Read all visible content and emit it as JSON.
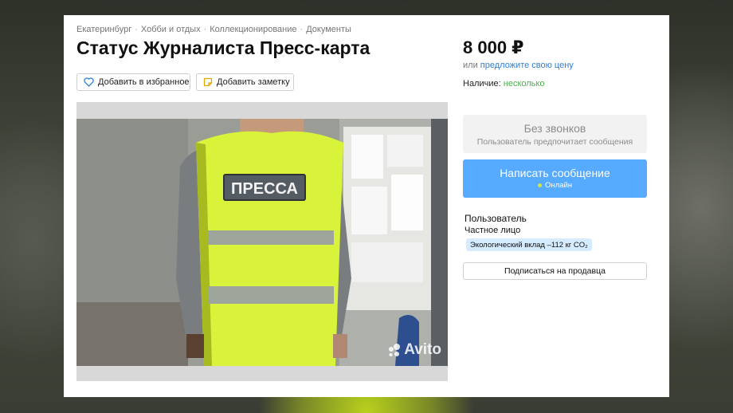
{
  "breadcrumbs": [
    "Екатеринбург",
    "Хобби и отдых",
    "Коллекционирование",
    "Документы"
  ],
  "breadcrumb_separator": "·",
  "listing": {
    "title": "Статус Журналиста Пресс-карта",
    "add_favorite_label": "Добавить в избранное",
    "add_note_label": "Добавить заметку"
  },
  "photo": {
    "vest_text": "ПРЕССА",
    "watermark": "Avito"
  },
  "price": {
    "amount": "8 000 ₽",
    "or_label": "или",
    "offer_link": "предложите свою цену"
  },
  "availability": {
    "label": "Наличие:",
    "value": "несколько"
  },
  "contact": {
    "no_calls_title": "Без звонков",
    "no_calls_subtitle": "Пользователь предпочитает сообщения",
    "message_button": "Написать сообщение",
    "online_status": "Онлайн"
  },
  "seller": {
    "role": "Пользователь",
    "type": "Частное лицо",
    "eco_badge": "Экологический вклад –112 кг CO₂",
    "subscribe_button": "Подписаться на продавца"
  },
  "colors": {
    "accent_blue": "#56aaff",
    "link_blue": "#2c7fd8",
    "available_green": "#4caf50",
    "eco_badge_bg": "#d5ebff",
    "vest_yellow": "#d9f23a"
  }
}
